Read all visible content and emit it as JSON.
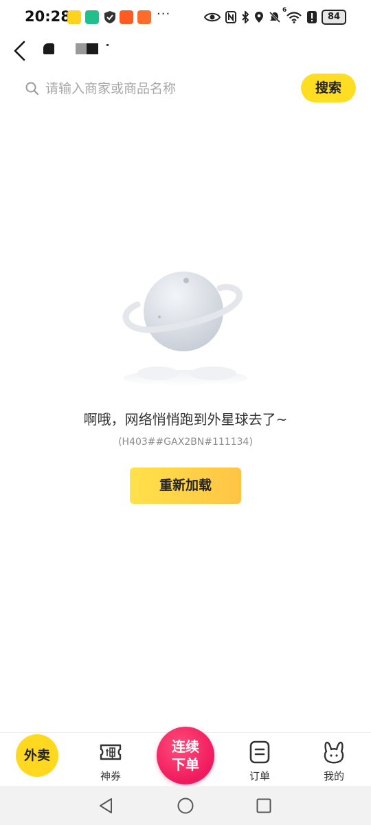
{
  "status_bar": {
    "time": "20:28",
    "more": "···",
    "network": "6",
    "battery": "84"
  },
  "header": {
    "back_icon": "chevron-left-icon"
  },
  "search": {
    "placeholder": "请输入商家或商品名称",
    "button_label": "搜索",
    "icon": "search-icon"
  },
  "empty_state": {
    "illustration": "planet-icon",
    "message": "啊哦，网络悄悄跑到外星球去了~",
    "error_code": "(H403##GAX2BN#111134)",
    "reload_label": "重新加载"
  },
  "tab_bar": {
    "tabs": [
      {
        "label": "外卖",
        "icon": "waimai-badge"
      },
      {
        "label": "神券",
        "icon": "coupon-icon"
      },
      {
        "label_line1": "连续",
        "label_line2": "下单",
        "icon": "combo-badge"
      },
      {
        "label": "订单",
        "icon": "order-icon"
      },
      {
        "label": "我的",
        "icon": "profile-icon"
      }
    ]
  },
  "colors": {
    "accent_yellow": "#ffdd22",
    "combo_pink": "#f0195e"
  }
}
